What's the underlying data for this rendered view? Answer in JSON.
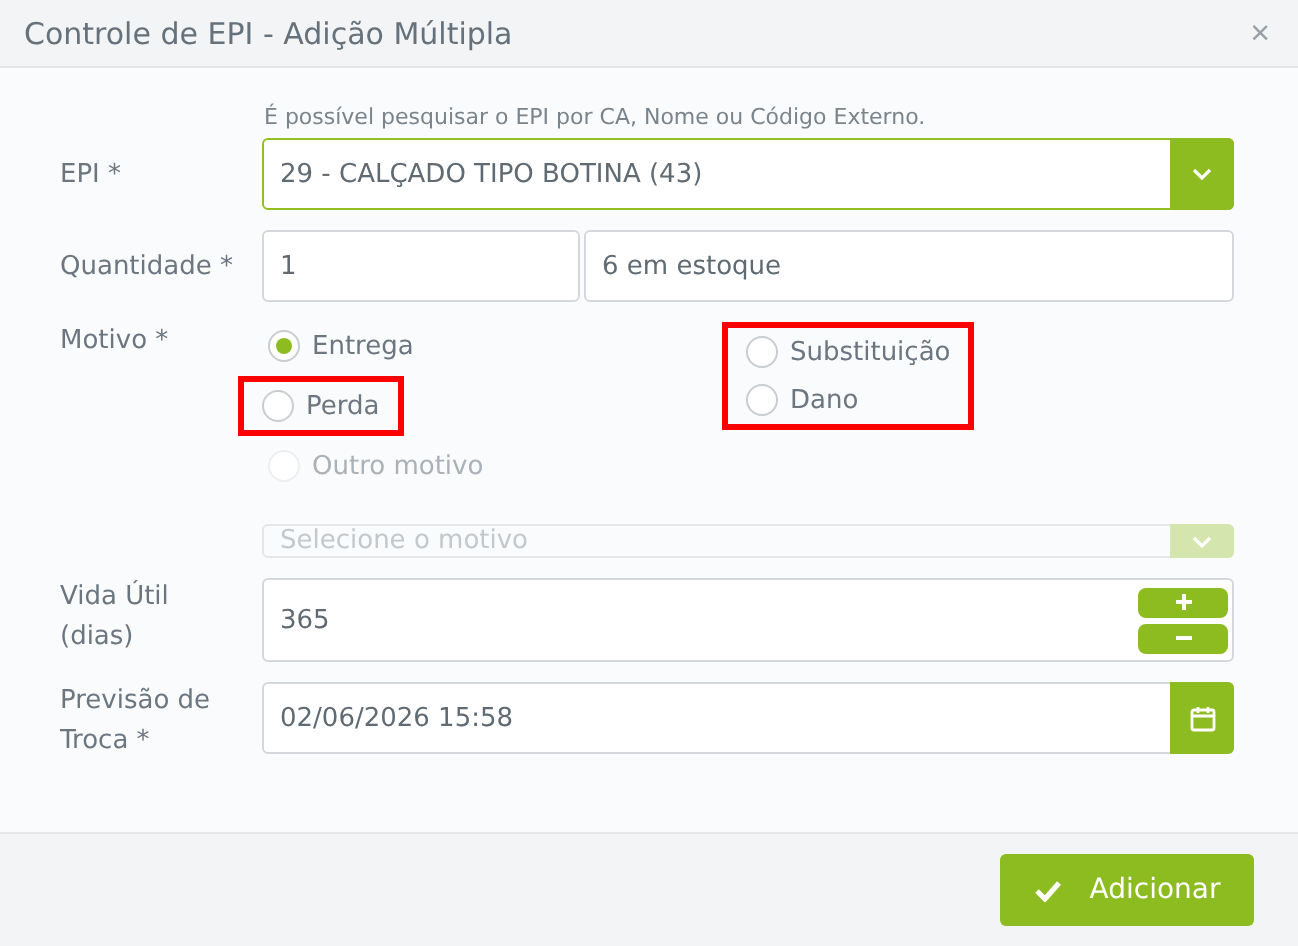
{
  "dialog": {
    "title": "Controle de EPI - Adição Múltipla",
    "close": "×"
  },
  "hint": "É possível pesquisar o EPI por CA, Nome ou Código Externo.",
  "epi": {
    "label": "EPI *",
    "value": "29 - CALÇADO TIPO BOTINA (43)"
  },
  "quantidade": {
    "label": "Quantidade *",
    "value": "1",
    "stock": "6 em estoque"
  },
  "motivo": {
    "label": "Motivo *",
    "columns": [
      [
        {
          "label": "Entrega",
          "selected": true,
          "disabled": false,
          "highlighted": false
        },
        {
          "label": "Perda",
          "selected": false,
          "disabled": false,
          "highlighted": true
        },
        {
          "label": "Outro motivo",
          "selected": false,
          "disabled": true,
          "highlighted": false
        }
      ],
      [
        {
          "label": "Substituição",
          "selected": false,
          "disabled": false,
          "highlighted": true
        },
        {
          "label": "Dano",
          "selected": false,
          "disabled": false,
          "highlighted": true
        }
      ]
    ],
    "select": {
      "placeholder": "Selecione o motivo",
      "disabled": true
    }
  },
  "vida_util": {
    "label": "Vida Útil (dias)",
    "value": "365"
  },
  "previsao": {
    "label": "Previsão de Troca *",
    "value": "02/06/2026 15:58"
  },
  "submit": "Adicionar"
}
